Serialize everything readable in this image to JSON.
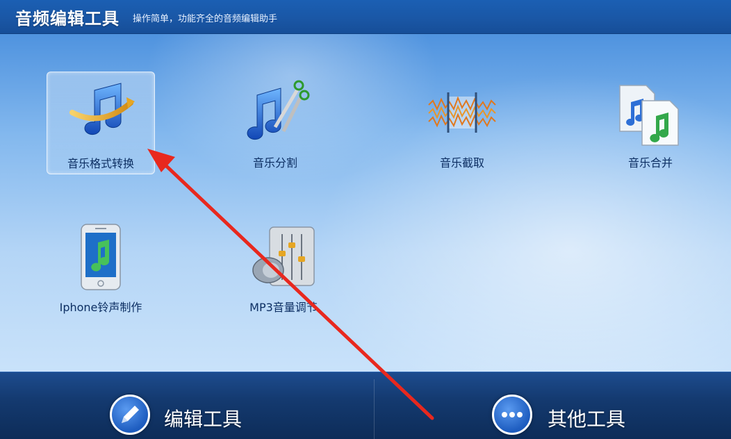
{
  "header": {
    "title": "音频编辑工具",
    "subtitle": "操作简单，功能齐全的音频编辑助手"
  },
  "tools": [
    {
      "label": "音乐格式转换",
      "icon": "music-convert-icon",
      "selected": true
    },
    {
      "label": "音乐分割",
      "icon": "music-scissors-icon",
      "selected": false
    },
    {
      "label": "音乐截取",
      "icon": "waveform-trim-icon",
      "selected": false
    },
    {
      "label": "音乐合并",
      "icon": "music-files-merge-icon",
      "selected": false
    },
    {
      "label": "Iphone铃声制作",
      "icon": "iphone-ringtone-icon",
      "selected": false
    },
    {
      "label": "MP3音量调节",
      "icon": "volume-mixer-icon",
      "selected": false
    }
  ],
  "bottom_bar": {
    "edit_tools_label": "编辑工具",
    "other_tools_label": "其他工具"
  },
  "colors": {
    "accent_blue": "#1d5cbf",
    "annotation_arrow": "#e8281e",
    "header_bg": "#1a57a6"
  }
}
